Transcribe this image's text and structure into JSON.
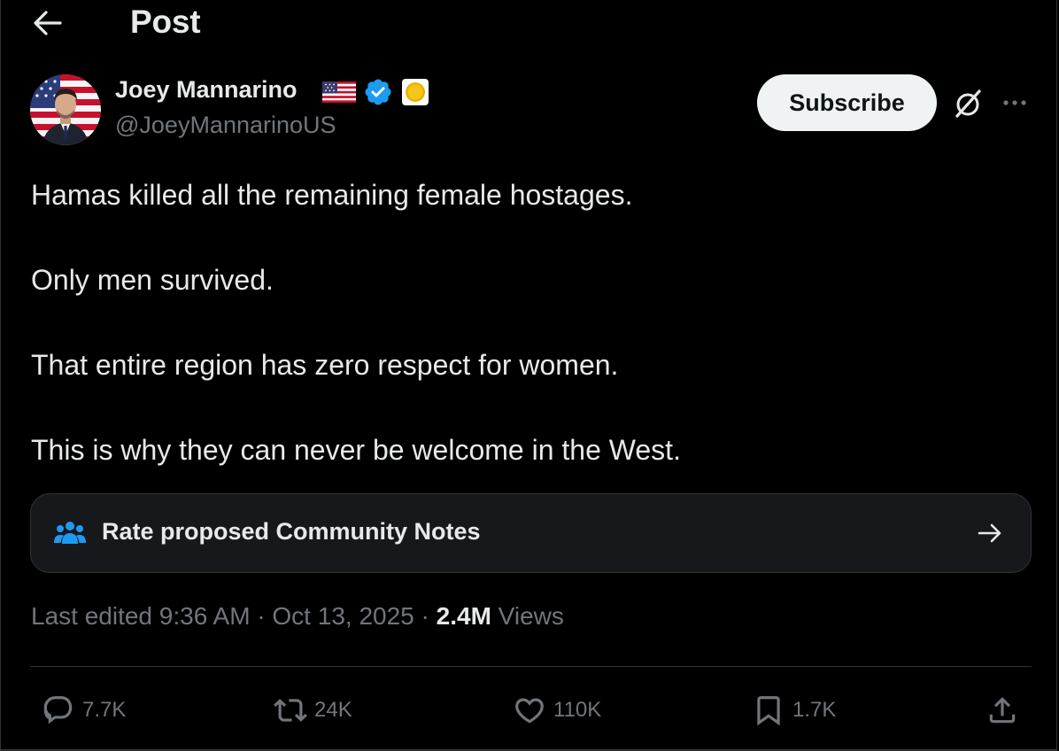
{
  "header": {
    "title": "Post",
    "back_icon": "arrow-left-icon"
  },
  "author": {
    "name": "Joey Mannarino",
    "handle": "@JoeyMannarinoUS",
    "badges": [
      "us-flag-icon",
      "verified-badge-icon",
      "affiliate-badge-icon"
    ],
    "verified_color": "#1d9bf0"
  },
  "actions_top": {
    "subscribe_label": "Subscribe",
    "grok_icon": "grok-icon",
    "more_icon": "more-horizontal-icon"
  },
  "post": {
    "paragraphs": [
      "Hamas killed all the remaining female hostages.",
      "Only men survived.",
      "That entire region has zero respect for women.",
      "This is why they can never be welcome in the West."
    ]
  },
  "community_notes": {
    "label": "Rate proposed Community Notes",
    "icon": "people-icon",
    "icon_color": "#1d9bf0",
    "arrow_icon": "arrow-right-icon"
  },
  "meta": {
    "edited_prefix": "Last edited",
    "time": "9:36 AM",
    "separator": "·",
    "date": "Oct 13, 2025",
    "views_count": "2.4M",
    "views_label": "Views"
  },
  "engagement": {
    "replies": "7.7K",
    "reposts": "24K",
    "likes": "110K",
    "bookmarks": "1.7K"
  },
  "colors": {
    "background": "#000000",
    "text_primary": "#e7e9ea",
    "text_secondary": "#71767b",
    "border": "#2f3336"
  }
}
